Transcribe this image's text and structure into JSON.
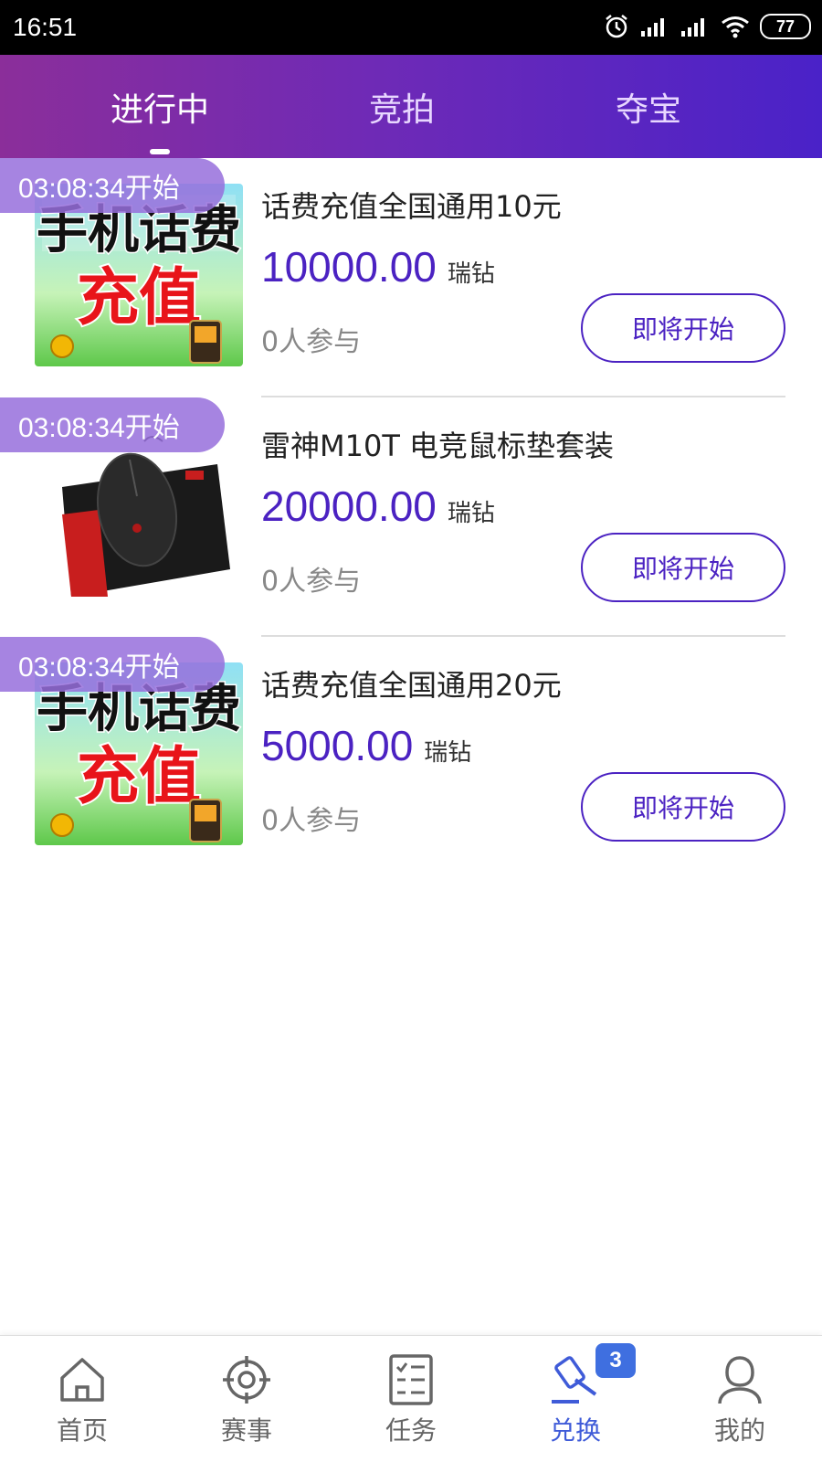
{
  "status_bar": {
    "time": "16:51",
    "battery": "77"
  },
  "tabs": [
    {
      "label": "进行中",
      "active": true
    },
    {
      "label": "竞拍",
      "active": false
    },
    {
      "label": "夺宝",
      "active": false
    }
  ],
  "items": [
    {
      "badge": "03:08:34开始",
      "image": "phone-recharge-image",
      "image_text": {
        "line1": "手机话费",
        "line2": "充值"
      },
      "title": "话费充值全国通用10元",
      "price": "10000.00",
      "unit": "瑞钻",
      "participants": "0人参与",
      "button": "即将开始"
    },
    {
      "badge": "03:08:34开始",
      "image": "gaming-mouse-mousepad-image",
      "title": "雷神M10T 电竞鼠标垫套装",
      "price": "20000.00",
      "unit": "瑞钻",
      "participants": "0人参与",
      "button": "即将开始"
    },
    {
      "badge": "03:08:34开始",
      "image": "phone-recharge-image",
      "image_text": {
        "line1": "手机话费",
        "line2": "充值"
      },
      "title": "话费充值全国通用20元",
      "price": "5000.00",
      "unit": "瑞钻",
      "participants": "0人参与",
      "button": "即将开始"
    }
  ],
  "bottom_nav": [
    {
      "label": "首页",
      "icon": "home-icon",
      "active": false
    },
    {
      "label": "赛事",
      "icon": "target-icon",
      "active": false
    },
    {
      "label": "任务",
      "icon": "task-list-icon",
      "active": false
    },
    {
      "label": "兑换",
      "icon": "gavel-icon",
      "active": true,
      "badge": "3"
    },
    {
      "label": "我的",
      "icon": "user-icon",
      "active": false
    }
  ],
  "colors": {
    "accent": "#4b22c2",
    "header_start": "#8b2e9a",
    "header_end": "#4a22c8",
    "nav_active": "#3f5bd8"
  }
}
